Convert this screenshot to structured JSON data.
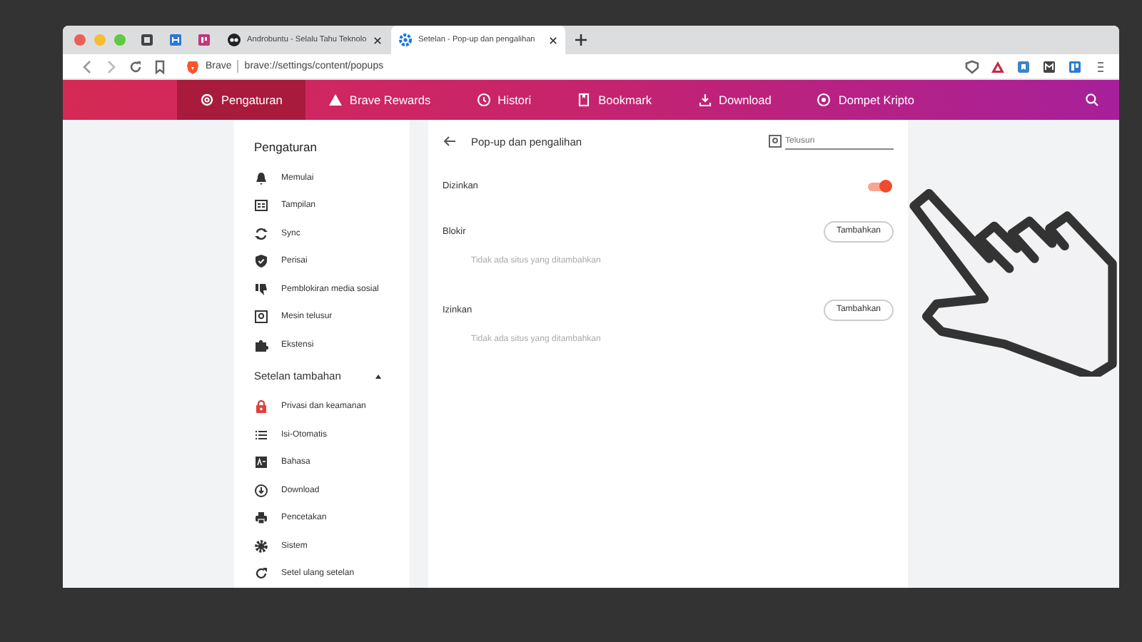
{
  "tabs": [
    {
      "title": "Androbuntu - Selalu Tahu Teknolo",
      "selected": false
    },
    {
      "title": "Setelan - Pop-up dan pengalihan",
      "selected": true
    }
  ],
  "address_bar": {
    "site_label": "Brave",
    "url": "brave://settings/content/popups"
  },
  "nav": [
    {
      "label": "Pengaturan",
      "selected": true
    },
    {
      "label": "Brave Rewards",
      "selected": false
    },
    {
      "label": "Histori",
      "selected": false
    },
    {
      "label": "Bookmark",
      "selected": false
    },
    {
      "label": "Download",
      "selected": false
    },
    {
      "label": "Dompet Kripto",
      "selected": false
    }
  ],
  "sidebar": {
    "heading": "Pengaturan",
    "items": [
      {
        "label": "Memulai"
      },
      {
        "label": "Tampilan"
      },
      {
        "label": "Sync"
      },
      {
        "label": "Perisai"
      },
      {
        "label": "Pemblokiran media sosial"
      },
      {
        "label": "Mesin telusur"
      },
      {
        "label": "Ekstensi"
      }
    ],
    "section": {
      "label": "Setelan tambahan",
      "expanded": true
    },
    "section_items": [
      {
        "label": "Privasi dan keamanan"
      },
      {
        "label": "Isi-Otomatis"
      },
      {
        "label": "Bahasa"
      },
      {
        "label": "Download"
      },
      {
        "label": "Pencetakan"
      },
      {
        "label": "Sistem"
      },
      {
        "label": "Setel ulang setelan"
      }
    ]
  },
  "page": {
    "title": "Pop-up dan pengalihan",
    "search": {
      "placeholder": "Telusuri"
    },
    "toggle": {
      "label": "Dizinkan",
      "on": true
    },
    "sections": [
      {
        "label": "Blokir",
        "button": "Tambahkan",
        "empty": "Tidak ada situs yang ditambahkan"
      },
      {
        "label": "Izinkan",
        "button": "Tambahkan",
        "empty": "Tidak ada situs yang ditambahkan"
      }
    ]
  }
}
